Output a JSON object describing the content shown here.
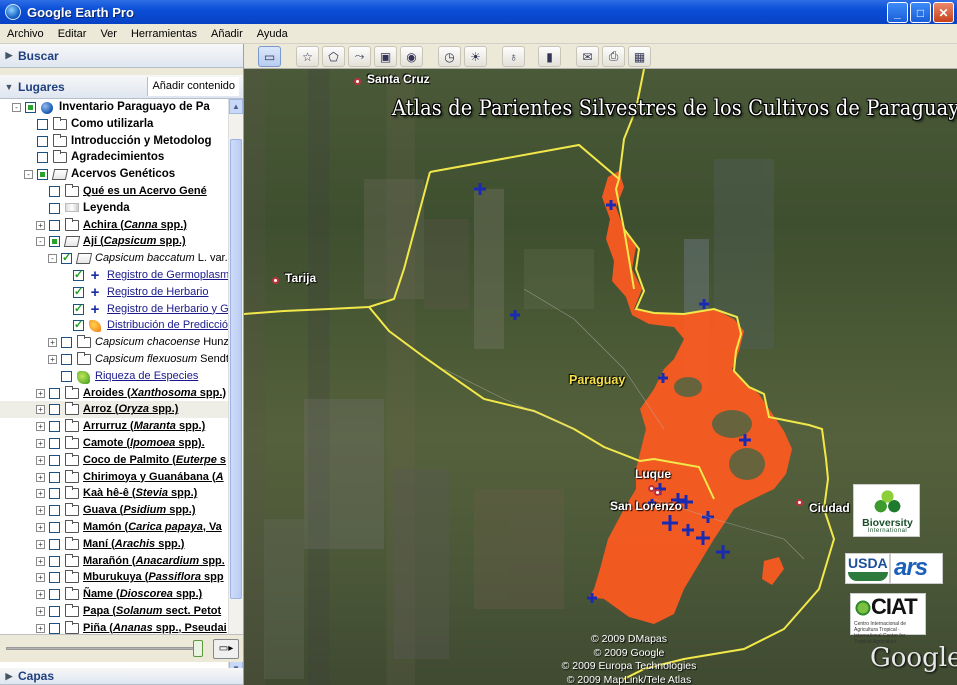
{
  "window": {
    "title": "Google Earth Pro",
    "buttons": [
      "_",
      "□",
      "✕"
    ]
  },
  "menu": [
    "Archivo",
    "Editar",
    "Ver",
    "Herramientas",
    "Añadir",
    "Ayuda"
  ],
  "search_panel": {
    "label": "Buscar"
  },
  "places_panel": {
    "label": "Lugares",
    "add_content": "Añadir contenido",
    "tree": [
      {
        "depth": 0,
        "expander": "-",
        "check": "partial",
        "icon": "globe",
        "label": "Inventario Paraguayo de Pa",
        "style": "bold"
      },
      {
        "depth": 1,
        "expander": "",
        "check": "unchecked",
        "icon": "folder",
        "label": "Como utilizarla",
        "style": "bold"
      },
      {
        "depth": 1,
        "expander": "",
        "check": "unchecked",
        "icon": "folder",
        "label": "Introducción y Metodolog",
        "style": "bold"
      },
      {
        "depth": 1,
        "expander": "",
        "check": "unchecked",
        "icon": "folder",
        "label": "Agradecimientos",
        "style": "bold"
      },
      {
        "depth": 1,
        "expander": "-",
        "check": "partial",
        "icon": "openfolder",
        "label": "Acervos Genéticos",
        "style": "bold"
      },
      {
        "depth": 2,
        "expander": "",
        "check": "unchecked",
        "icon": "folder",
        "label": "Qué es un Acervo Gené",
        "style": "blink"
      },
      {
        "depth": 2,
        "expander": "",
        "check": "unchecked",
        "icon": "legend",
        "label": "Leyenda",
        "style": "bold"
      },
      {
        "depth": 2,
        "expander": "+",
        "check": "unchecked",
        "icon": "folder",
        "label": "Achira (",
        "label_it": "Canna",
        "label_end": " spp.)",
        "style": "blink"
      },
      {
        "depth": 2,
        "expander": "-",
        "check": "partial",
        "icon": "openfolder",
        "label": "Ají (",
        "label_it": "Capsicum",
        "label_end": " spp.)",
        "style": "blink"
      },
      {
        "depth": 3,
        "expander": "-",
        "check": "checked",
        "icon": "openfolder",
        "label": "",
        "label_it": "Capsicum baccatum",
        "label_end": " L. var.",
        "style": "plain"
      },
      {
        "depth": 4,
        "expander": "",
        "check": "checked",
        "icon": "plus",
        "label": "Registro de Germoplasma",
        "style": "link"
      },
      {
        "depth": 4,
        "expander": "",
        "check": "checked",
        "icon": "plus",
        "label": "Registro de Herbario",
        "style": "link"
      },
      {
        "depth": 4,
        "expander": "",
        "check": "checked",
        "icon": "plus",
        "label": "Registro de Herbario y Ger",
        "style": "link"
      },
      {
        "depth": 4,
        "expander": "",
        "check": "checked",
        "icon": "pred",
        "label": "Distribución de Predicción",
        "style": "link"
      },
      {
        "depth": 3,
        "expander": "+",
        "check": "unchecked",
        "icon": "folder",
        "label": "",
        "label_it": "Capsicum chacoense",
        "label_end": " Hunz.",
        "style": "plain"
      },
      {
        "depth": 3,
        "expander": "+",
        "check": "unchecked",
        "icon": "folder",
        "label": "",
        "label_it": "Capsicum flexuosum",
        "label_end": " Sendtn.",
        "style": "plain"
      },
      {
        "depth": 3,
        "expander": "",
        "check": "unchecked",
        "icon": "rich",
        "label": "Riqueza de Especies",
        "style": "link"
      },
      {
        "depth": 2,
        "expander": "+",
        "check": "unchecked",
        "icon": "folder",
        "label": "Aroides (",
        "label_it": "Xanthosoma",
        "label_end": " spp.)",
        "style": "blink"
      },
      {
        "depth": 2,
        "expander": "+",
        "check": "unchecked",
        "icon": "folder",
        "label": "Arroz (",
        "label_it": "Oryza",
        "label_end": " spp.)",
        "style": "blink",
        "highlight": true
      },
      {
        "depth": 2,
        "expander": "+",
        "check": "unchecked",
        "icon": "folder",
        "label": "Arrurruz (",
        "label_it": "Maranta",
        "label_end": " spp.)",
        "style": "blink"
      },
      {
        "depth": 2,
        "expander": "+",
        "check": "unchecked",
        "icon": "folder",
        "label": "Camote (",
        "label_it": "Ipomoea",
        "label_end": " spp).",
        "style": "blink"
      },
      {
        "depth": 2,
        "expander": "+",
        "check": "unchecked",
        "icon": "folder",
        "label": "Coco de Palmito (",
        "label_it": "Euterpe",
        "label_end": " s",
        "style": "blink"
      },
      {
        "depth": 2,
        "expander": "+",
        "check": "unchecked",
        "icon": "folder",
        "label": "Chirimoya y Guanábana (",
        "label_it": "A",
        "label_end": "",
        "style": "blink"
      },
      {
        "depth": 2,
        "expander": "+",
        "check": "unchecked",
        "icon": "folder",
        "label": "Kaà hê-ê (",
        "label_it": "Stevia",
        "label_end": " spp.)",
        "style": "blink"
      },
      {
        "depth": 2,
        "expander": "+",
        "check": "unchecked",
        "icon": "folder",
        "label": "Guava (",
        "label_it": "Psidium",
        "label_end": " spp.)",
        "style": "blink"
      },
      {
        "depth": 2,
        "expander": "+",
        "check": "unchecked",
        "icon": "folder",
        "label": "Mamón (",
        "label_it": "Carica papaya",
        "label_end": ", Va",
        "style": "blink"
      },
      {
        "depth": 2,
        "expander": "+",
        "check": "unchecked",
        "icon": "folder",
        "label": "Maní (",
        "label_it": "Arachis",
        "label_end": " spp.)",
        "style": "blink"
      },
      {
        "depth": 2,
        "expander": "+",
        "check": "unchecked",
        "icon": "folder",
        "label": "Marañón (",
        "label_it": "Anacardium",
        "label_end": " spp.",
        "style": "blink"
      },
      {
        "depth": 2,
        "expander": "+",
        "check": "unchecked",
        "icon": "folder",
        "label": "Mburukuya (",
        "label_it": "Passiflora",
        "label_end": " spp",
        "style": "blink"
      },
      {
        "depth": 2,
        "expander": "+",
        "check": "unchecked",
        "icon": "folder",
        "label": "Ñame (",
        "label_it": "Dioscorea",
        "label_end": " spp.)",
        "style": "blink"
      },
      {
        "depth": 2,
        "expander": "+",
        "check": "unchecked",
        "icon": "folder",
        "label": "Papa (",
        "label_it": "Solanum",
        "label_end": " sect. Petot",
        "style": "blink"
      },
      {
        "depth": 2,
        "expander": "+",
        "check": "unchecked",
        "icon": "folder",
        "label": "Piña (",
        "label_it": "Ananas",
        "label_end": " spp., Pseudai",
        "style": "blink"
      }
    ]
  },
  "layers_panel": {
    "label": "Capas"
  },
  "toolbar": {
    "buttons": [
      {
        "name": "sidebar-toggle",
        "icon": "▭",
        "active": true
      },
      {
        "name": "add-placemark",
        "icon": "☆"
      },
      {
        "name": "add-polygon",
        "icon": "⬠"
      },
      {
        "name": "add-path",
        "icon": "⤳"
      },
      {
        "name": "add-image-overlay",
        "icon": "▣"
      },
      {
        "name": "record-tour",
        "icon": "◉"
      },
      {
        "name": "historical-imagery",
        "icon": "◷"
      },
      {
        "name": "sunlight",
        "icon": "☀"
      },
      {
        "name": "switch-planet",
        "icon": "♁"
      },
      {
        "name": "ruler",
        "icon": "▮"
      },
      {
        "name": "email",
        "icon": "✉"
      },
      {
        "name": "print",
        "icon": "⎙"
      },
      {
        "name": "save-image",
        "icon": "▦"
      }
    ]
  },
  "map": {
    "title": "Atlas de Parientes Silvestres de los Cultivos de Paraguay",
    "places": [
      {
        "name": "Santa Cruz",
        "pin": true
      },
      {
        "name": "Tarija",
        "pin": true
      },
      {
        "name": "Paraguay",
        "pin": false,
        "yellow": true
      },
      {
        "name": "Luque",
        "pin": true
      },
      {
        "name": "San Lorenzo",
        "pin": true
      },
      {
        "name": "Ciudad",
        "pin": true
      }
    ],
    "credits": [
      "© 2009 DMapas",
      "© 2009 Google",
      "© 2009 Europa Technologies",
      "© 2009 MapLink/Tele Atlas"
    ],
    "google_logo": "Google",
    "logos": {
      "bioversity": "Bioversity",
      "bioversity_sub": "International",
      "usda": "USDA",
      "ars": "ars",
      "ciat": "CIAT",
      "ciat_sub": "Centro Internacional de Agricultura Tropical · International Center for Tropical Agriculture"
    },
    "colors": {
      "border": "#f2e84a",
      "distribution": "#ff5a1f",
      "marker": "#1b2bb0"
    }
  }
}
